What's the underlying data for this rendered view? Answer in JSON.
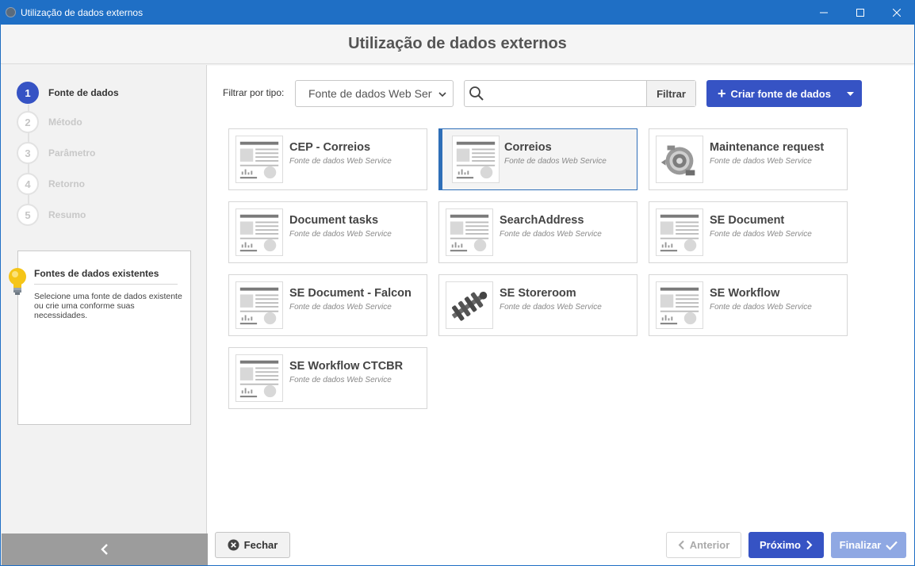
{
  "window": {
    "title": "Utilização de dados externos",
    "controls": [
      "minimize-icon",
      "maximize-icon",
      "close-icon"
    ]
  },
  "header": {
    "title": "Utilização de dados externos"
  },
  "steps": [
    {
      "num": "1",
      "label": "Fonte de dados",
      "active": true
    },
    {
      "num": "2",
      "label": "Método",
      "active": false
    },
    {
      "num": "3",
      "label": "Parâmetro",
      "active": false
    },
    {
      "num": "4",
      "label": "Retorno",
      "active": false
    },
    {
      "num": "5",
      "label": "Resumo",
      "active": false
    }
  ],
  "tip": {
    "title": "Fontes de dados existentes",
    "text": "Selecione uma fonte de dados existente ou crie uma conforme suas necessidades.",
    "icon": "lightbulb-icon"
  },
  "filter": {
    "label": "Filtrar por tipo:",
    "selected_type": "Fonte de dados Web Service",
    "search_value": "",
    "filter_button": "Filtrar",
    "create_button": "Criar fonte de dados"
  },
  "cards": [
    {
      "name": "CEP - Correios",
      "type": "Fonte de dados Web Service",
      "thumb": "document-placeholder",
      "selected": false
    },
    {
      "name": "Correios",
      "type": "Fonte de dados Web Service",
      "thumb": "document-placeholder",
      "selected": true
    },
    {
      "name": "Maintenance request",
      "type": "Fonte de dados Web Service",
      "thumb": "alternator-photo",
      "selected": false
    },
    {
      "name": "Document tasks",
      "type": "Fonte de dados Web Service",
      "thumb": "document-placeholder",
      "selected": false
    },
    {
      "name": "SearchAddress",
      "type": "Fonte de dados Web Service",
      "thumb": "document-placeholder",
      "selected": false
    },
    {
      "name": "SE Document",
      "type": "Fonte de dados Web Service",
      "thumb": "document-placeholder",
      "selected": false
    },
    {
      "name": "SE Document - Falcon",
      "type": "Fonte de dados Web Service",
      "thumb": "document-placeholder",
      "selected": false
    },
    {
      "name": "SE Storeroom",
      "type": "Fonte de dados Web Service",
      "thumb": "crankshaft-photo",
      "selected": false
    },
    {
      "name": "SE Workflow",
      "type": "Fonte de dados Web Service",
      "thumb": "document-placeholder",
      "selected": false
    },
    {
      "name": "SE Workflow CTCBR",
      "type": "Fonte de dados Web Service",
      "thumb": "document-placeholder",
      "selected": false
    }
  ],
  "footer": {
    "close": "Fechar",
    "prev": "Anterior",
    "next": "Próximo",
    "finish": "Finalizar"
  },
  "colors": {
    "titlebar": "#1f6fc5",
    "accent": "#3653c4",
    "accent_disabled": "#8fa8e3",
    "selected_border": "#2f6fb8"
  }
}
